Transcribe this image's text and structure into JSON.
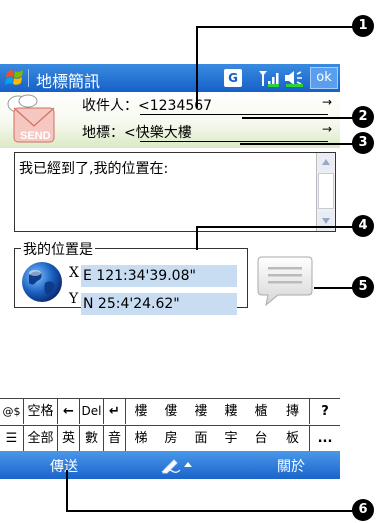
{
  "titlebar": {
    "title": "地標簡訊",
    "g_label": "G",
    "ok_label": "ok",
    "start_icon": "windows-flag-icon",
    "signal_icon": "signal-strength-icon",
    "speaker_icon": "speaker-icon"
  },
  "header": {
    "send_label": "SEND",
    "recipient_label": "收件人：",
    "recipient_value": "<1234567",
    "landmark_label": "地標：",
    "landmark_value": "<快樂大樓",
    "arrow": "→"
  },
  "message": {
    "text": "我已經到了,我的位置在:"
  },
  "location": {
    "legend": "我的位置是",
    "x_label": "X",
    "x_value": "E 121:34'39.08\"",
    "y_label": "Y",
    "y_value": "N 25:4'24.62\""
  },
  "keyboard": {
    "row1": [
      "@$",
      "空格",
      "←",
      "Del",
      "↵",
      "樓",
      "僂",
      "褸",
      "耬",
      "樝",
      "摶",
      "?"
    ],
    "row2": [
      "☰",
      "全部",
      "英",
      "數",
      "音",
      "梯",
      "房",
      "面",
      "宇",
      "台",
      "板",
      "..."
    ]
  },
  "menubar": {
    "send_label": "傳送",
    "about_label": "關於",
    "pen_icon": "pen-input-icon"
  },
  "callouts": [
    "1",
    "2",
    "3",
    "4",
    "5",
    "6"
  ],
  "colors": {
    "titlebar": "#1560c8",
    "coord_box": "#c8dcf2",
    "send_icon_red": "#e05a4a"
  }
}
